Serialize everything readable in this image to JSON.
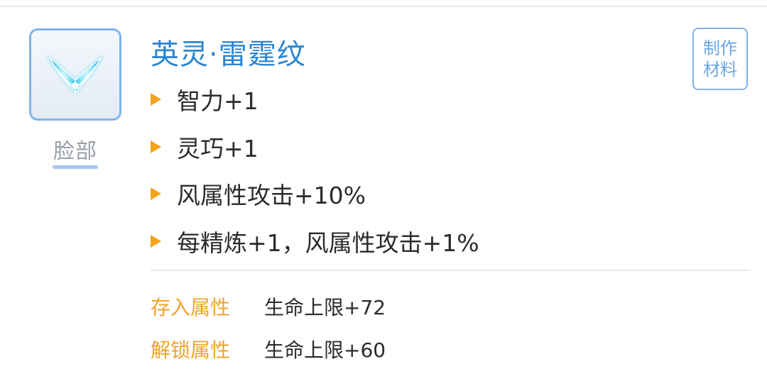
{
  "item": {
    "title": "英灵·雷霆纹",
    "slot_label": "脸部",
    "icon": "winged-crest-icon",
    "accent_color": "#2a86d2",
    "highlight_color": "#f5a31b"
  },
  "craft_button": {
    "line1": "制作",
    "line2": "材料"
  },
  "stats": [
    "智力+1",
    "灵巧+1",
    "风属性攻击+10%",
    "每精炼+1，风属性攻击+1%"
  ],
  "attributes": {
    "stored": {
      "label": "存入属性",
      "value": "生命上限+72"
    },
    "unlock": {
      "label": "解锁属性",
      "value": "生命上限+60"
    }
  }
}
